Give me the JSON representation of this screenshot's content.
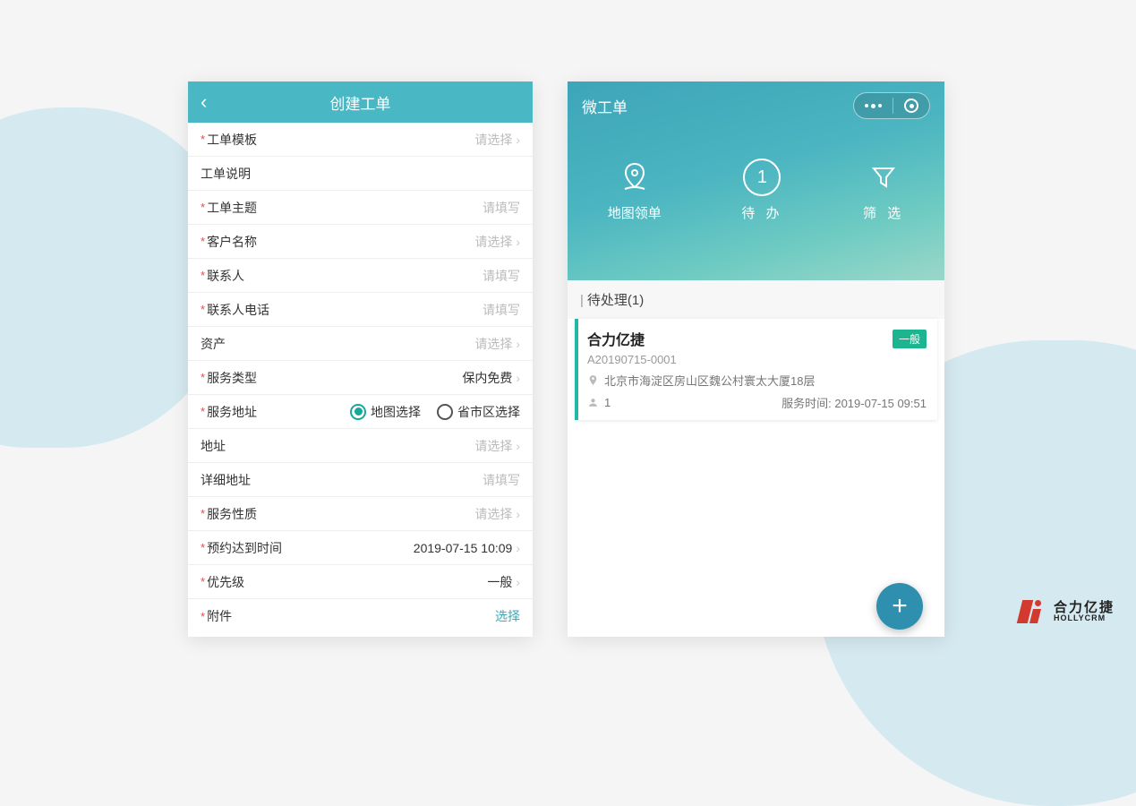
{
  "left": {
    "title": "创建工单",
    "rows": {
      "template": {
        "label": "工单模板",
        "ph": "请选择",
        "required": true
      },
      "desc": {
        "label": "工单说明",
        "required": false
      },
      "subject": {
        "label": "工单主题",
        "ph": "请填写",
        "required": true
      },
      "customer": {
        "label": "客户名称",
        "ph": "请选择",
        "required": true
      },
      "contact": {
        "label": "联系人",
        "ph": "请填写",
        "required": true
      },
      "phone": {
        "label": "联系人电话",
        "ph": "请填写",
        "required": true
      },
      "asset": {
        "label": "资产",
        "ph": "请选择",
        "required": false
      },
      "svcType": {
        "label": "服务类型",
        "val": "保内免费",
        "required": true
      },
      "svcAddr": {
        "label": "服务地址",
        "opt1": "地图选择",
        "opt2": "省市区选择",
        "required": true
      },
      "addr": {
        "label": "地址",
        "ph": "请选择",
        "required": false
      },
      "addrDetail": {
        "label": "详细地址",
        "ph": "请填写",
        "required": false
      },
      "svcNature": {
        "label": "服务性质",
        "ph": "请选择",
        "required": true
      },
      "appt": {
        "label": "预约达到时间",
        "val": "2019-07-15 10:09",
        "required": true
      },
      "priority": {
        "label": "优先级",
        "val": "一般",
        "required": true
      },
      "attach": {
        "label": "附件",
        "link": "选择",
        "required": true
      }
    }
  },
  "right": {
    "appName": "微工单",
    "nav": {
      "map": "地图领单",
      "todo": "待 办",
      "todoCount": "1",
      "filter": "筛 选"
    },
    "section": {
      "prefix": "|",
      "label": "待处理(1)"
    },
    "card": {
      "title": "合力亿捷",
      "badge": "一般",
      "code": "A20190715-0001",
      "address": "北京市海淀区房山区魏公村寰太大厦18层",
      "people": "1",
      "svcTimeLabel": "服务时间:",
      "svcTime": "2019-07-15 09:51"
    }
  },
  "brand": {
    "cn": "合力亿捷",
    "en": "HOLLYCRM"
  }
}
